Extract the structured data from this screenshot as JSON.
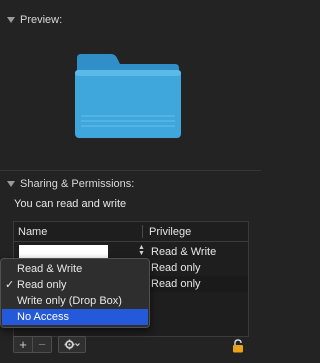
{
  "preview": {
    "title": "Preview:"
  },
  "sharing": {
    "title": "Sharing & Permissions:",
    "status": "You can read and write",
    "columns": {
      "name": "Name",
      "privilege": "Privilege"
    },
    "rows": [
      {
        "privilege": "Read & Write"
      },
      {
        "privilege": "Read only"
      },
      {
        "privilege": "Read only"
      }
    ]
  },
  "privilege_menu": {
    "items": [
      {
        "label": "Read & Write",
        "checked": false,
        "highlighted": false
      },
      {
        "label": "Read only",
        "checked": true,
        "highlighted": false
      },
      {
        "label": "Write only (Drop Box)",
        "checked": false,
        "highlighted": false
      },
      {
        "label": "No Access",
        "checked": false,
        "highlighted": true
      }
    ],
    "check_mark": "✓"
  },
  "toolbar": {
    "add": "+",
    "remove": "−"
  },
  "colors": {
    "folder": "#3fa7dc",
    "highlight": "#2459d9",
    "lock": "#e8a317"
  }
}
